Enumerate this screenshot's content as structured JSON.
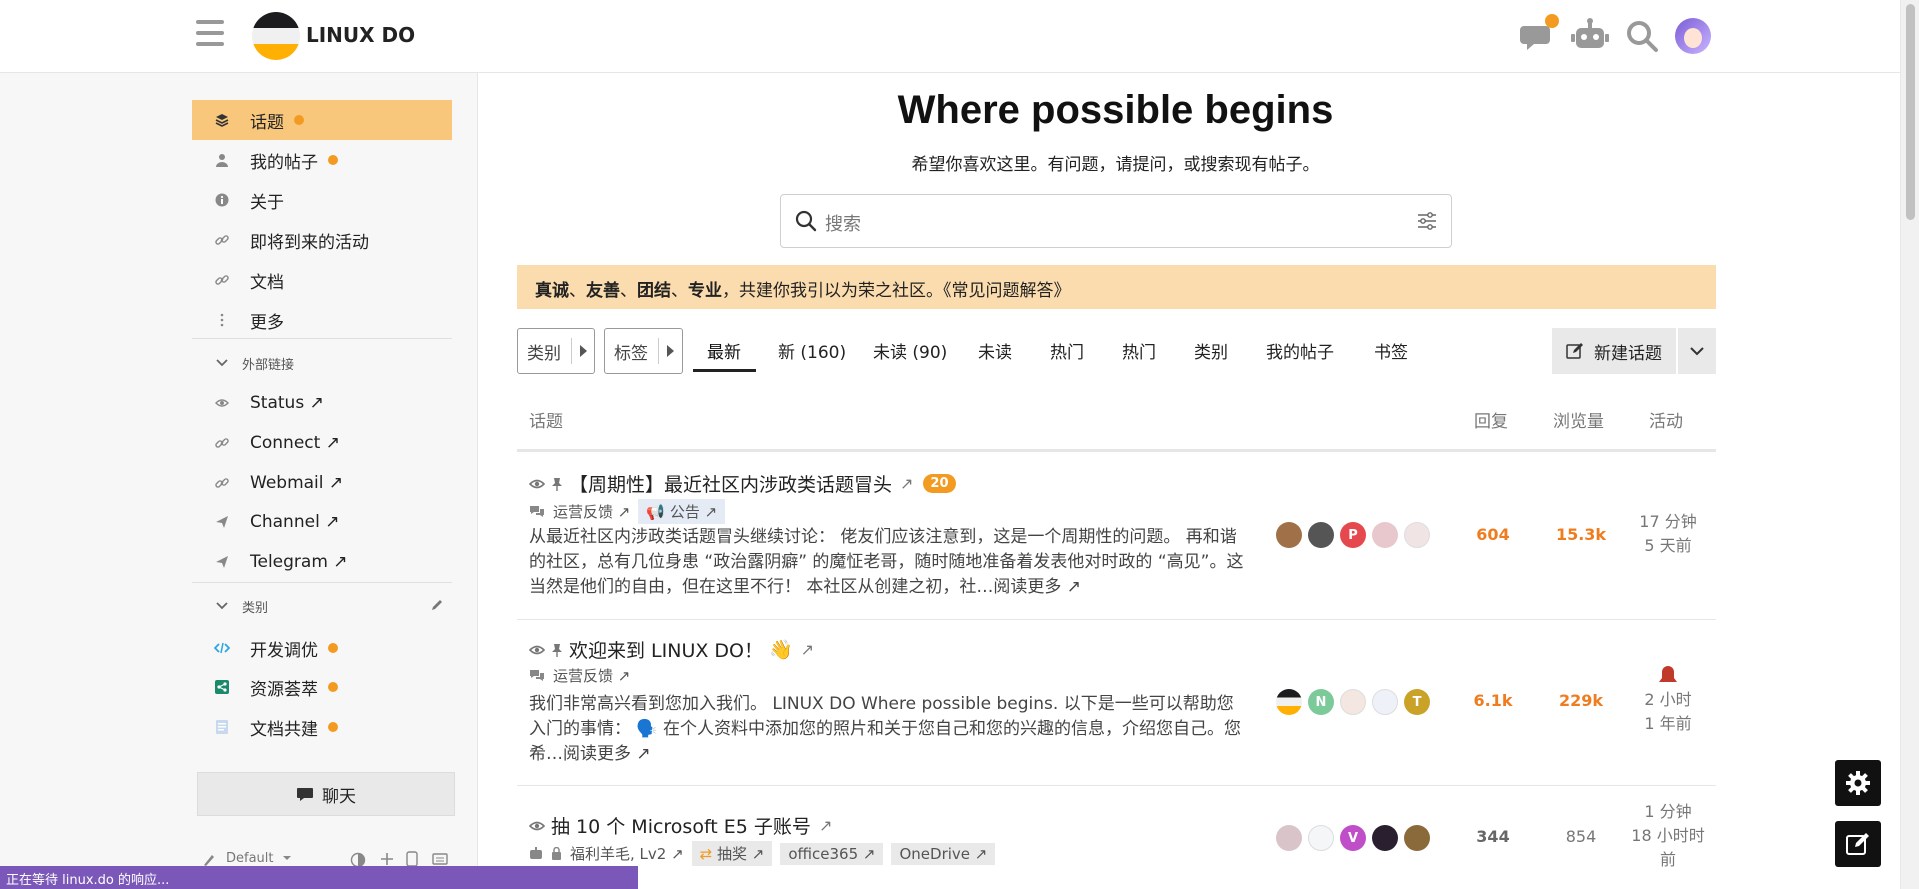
{
  "header": {
    "brand": "LINUX DO",
    "icons": [
      "hamburger-icon",
      "chat-icon",
      "robot-icon",
      "search-icon",
      "user-avatar"
    ]
  },
  "sidebar": {
    "items": [
      {
        "label": "话题",
        "icon": "layers-icon",
        "dot": true,
        "active": true
      },
      {
        "label": "我的帖子",
        "icon": "user-icon",
        "dot": true
      },
      {
        "label": "关于",
        "icon": "info-icon"
      },
      {
        "label": "即将到来的活动",
        "icon": "link-icon"
      },
      {
        "label": "文档",
        "icon": "link-icon"
      },
      {
        "label": "更多",
        "icon": "more-icon"
      }
    ],
    "external_header": "外部链接",
    "external_links": [
      {
        "label": "Status ↗",
        "icon": "eye-icon"
      },
      {
        "label": "Connect ↗",
        "icon": "link-icon"
      },
      {
        "label": "Webmail ↗",
        "icon": "link-icon"
      },
      {
        "label": "Channel ↗",
        "icon": "send-icon"
      },
      {
        "label": "Telegram ↗",
        "icon": "send-icon"
      }
    ],
    "categories_header": "类别",
    "categories": [
      {
        "label": "开发调优",
        "icon": "code-icon",
        "color": "#2aa7e0"
      },
      {
        "label": "资源荟萃",
        "icon": "share-icon",
        "color": "#1a8a6a"
      },
      {
        "label": "文档共建",
        "icon": "doc-icon",
        "color": "#9ab6d9"
      }
    ],
    "chat_label": "聊天",
    "bottom_label": "Default"
  },
  "status_bar": "正在等待 linux.do 的响应...",
  "hero": {
    "title": "Where possible begins",
    "subtitle": "希望你喜欢这里。有问题，请提问，或搜索现有帖子。"
  },
  "search": {
    "placeholder": "搜索"
  },
  "banner": {
    "b1": "真诚",
    "s1": "、",
    "b2": "友善",
    "s2": "、",
    "b3": "团结",
    "s3": "、",
    "b4": "专业",
    "rest": "，共建你我引以为荣之社区。《常见问题解答》"
  },
  "nav": {
    "categories_dd": "类别",
    "tags_dd": "标签",
    "tabs": [
      "最新",
      "新 (160)",
      "未读 (90)",
      "未读",
      "热门",
      "热门",
      "类别",
      "我的帖子",
      "书签"
    ],
    "new_topic": "新建话题"
  },
  "table": {
    "headers": {
      "topic": "话题",
      "replies": "回复",
      "views": "浏览量",
      "activity": "活动"
    },
    "rows": [
      {
        "title": "【周期性】最近社区内涉政类话题冒头",
        "badge": "20",
        "category": "运营反馈 ↗",
        "tag": "公告 ↗",
        "excerpt": "从最近社区内涉政类话题冒头继续讨论： 佬友们应该注意到，这是一个周期性的问题。 再和谐的社区，总有几位身患 “政治露阴癖” 的魔怔老哥，随时随地准备着发表他对时政的 “高见”。这当然是他们的自由，但在这里不行！ 本社区从创建之初，社…",
        "read_more": "阅读更多 ↗",
        "replies": "604",
        "views": "15.3k",
        "activity1": "17 分钟",
        "activity2": "5 天前"
      },
      {
        "title": "欢迎来到 LINUX DO！",
        "category": "运营反馈 ↗",
        "excerpt": "我们非常高兴看到您加入我们。 LINUX DO Where possible begins. 以下是一些可以帮助您入门的事情： 🗣️ 在个人资料中添加您的照片和关于您自己和您的兴趣的信息，介绍您自己。您希…",
        "read_more": "阅读更多 ↗",
        "replies": "6.1k",
        "views": "229k",
        "activity1": "2 小时",
        "activity2": "1 年前"
      },
      {
        "title": "抽 10 个 Microsoft E5 子账号",
        "category": "福利羊毛, Lv2 ↗",
        "tags": [
          "抽奖 ↗",
          "office365 ↗",
          "OneDrive ↗"
        ],
        "replies": "344",
        "views": "854",
        "activity1": "1 分钟",
        "activity2": "18 小时时",
        "activity3": "前"
      }
    ]
  },
  "colors": {
    "accent": "#f39b21",
    "active_bg": "#f8c77c",
    "banner_bg": "#fbdcae",
    "hot_number": "#ef7d20"
  }
}
